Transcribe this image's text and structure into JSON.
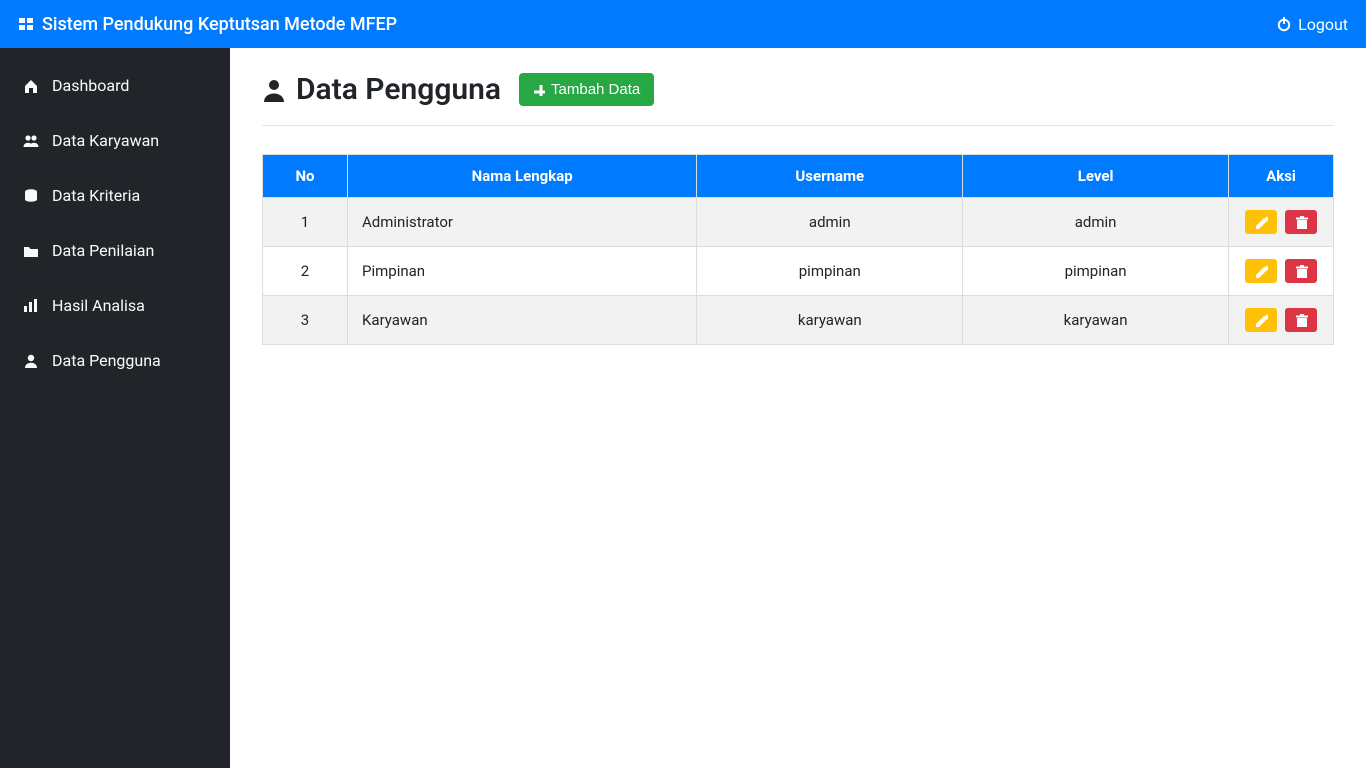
{
  "navbar": {
    "brand": "Sistem Pendukung Keptutsan Metode MFEP",
    "logout": "Logout"
  },
  "sidebar": {
    "items": [
      {
        "label": "Dashboard",
        "icon": "home-icon"
      },
      {
        "label": "Data Karyawan",
        "icon": "users-icon"
      },
      {
        "label": "Data Kriteria",
        "icon": "database-icon"
      },
      {
        "label": "Data Penilaian",
        "icon": "folder-icon"
      },
      {
        "label": "Hasil Analisa",
        "icon": "chart-bar-icon"
      },
      {
        "label": "Data Pengguna",
        "icon": "user-icon"
      }
    ]
  },
  "page": {
    "title": "Data Pengguna",
    "add_button": "Tambah Data"
  },
  "table": {
    "headers": {
      "no": "No",
      "nama": "Nama Lengkap",
      "username": "Username",
      "level": "Level",
      "aksi": "Aksi"
    },
    "rows": [
      {
        "no": "1",
        "nama": "Administrator",
        "username": "admin",
        "level": "admin"
      },
      {
        "no": "2",
        "nama": "Pimpinan",
        "username": "pimpinan",
        "level": "pimpinan"
      },
      {
        "no": "3",
        "nama": "Karyawan",
        "username": "karyawan",
        "level": "karyawan"
      }
    ]
  }
}
